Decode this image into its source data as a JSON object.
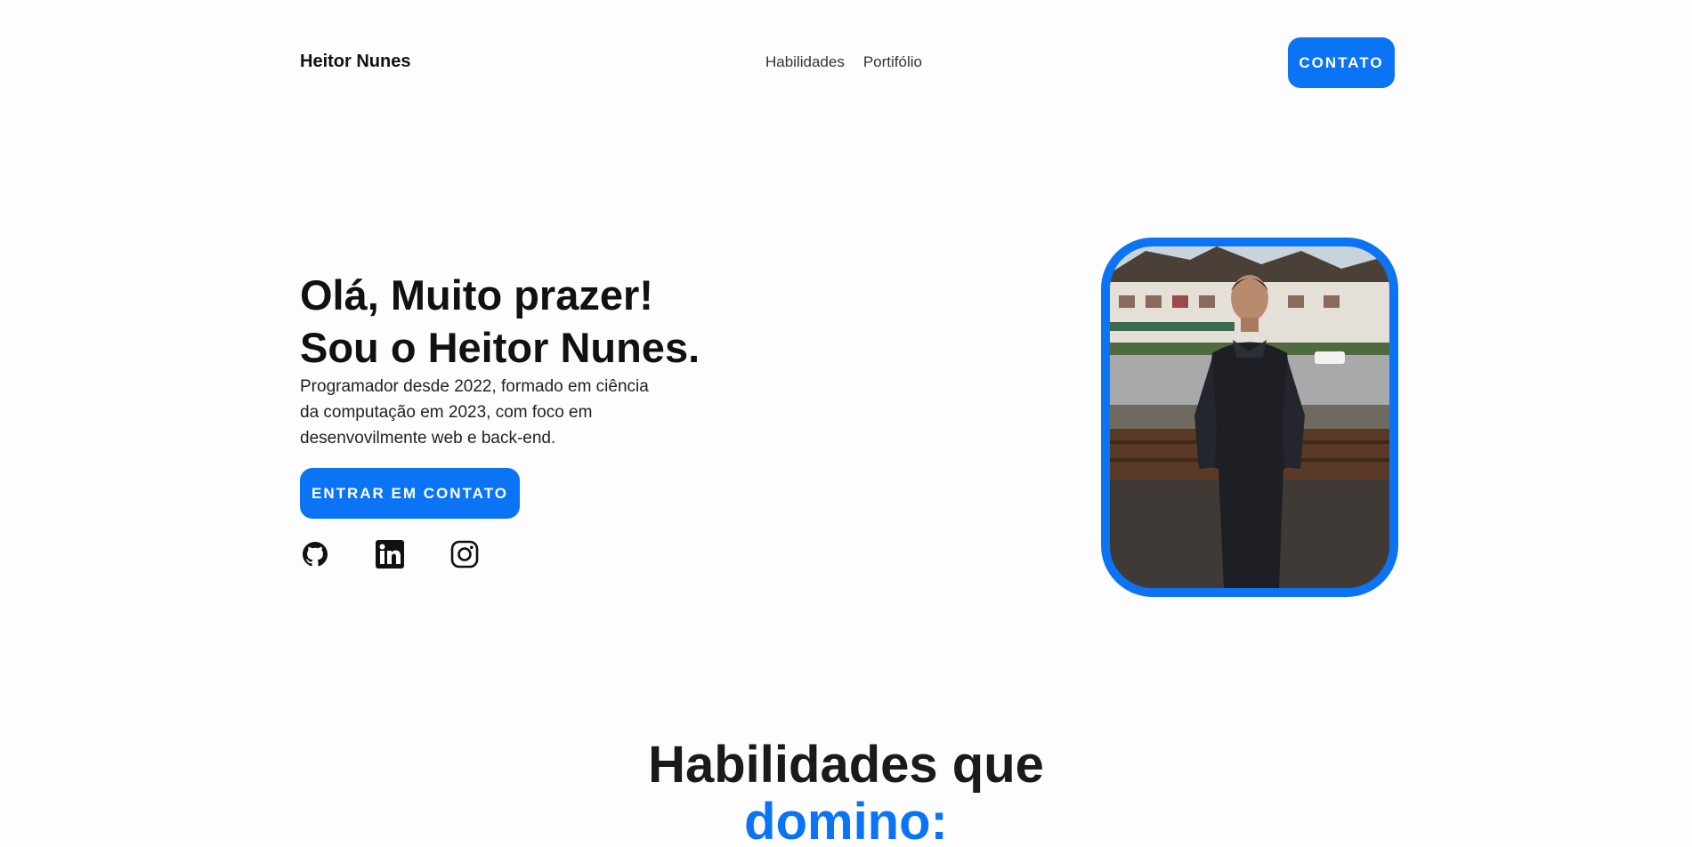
{
  "header": {
    "brand": "Heitor Nunes",
    "nav": [
      "Habilidades",
      "Portifólio"
    ],
    "contact_button": "CONTATO"
  },
  "hero": {
    "title_line1": "Olá, Muito prazer!",
    "title_line2": "Sou o Heitor Nunes.",
    "description": "Programador desde 2022, formado em ciência da computação em 2023, com foco em desenvovilmente web e back-end.",
    "cta_button": "ENTRAR EM CONTATO",
    "socials": [
      "github-icon",
      "linkedin-icon",
      "instagram-icon"
    ]
  },
  "skills": {
    "heading_part1": "Habilidades que",
    "heading_part2": "domino:"
  },
  "colors": {
    "accent": "#0a74f5",
    "text": "#111111",
    "background": "#fdfdfd"
  }
}
